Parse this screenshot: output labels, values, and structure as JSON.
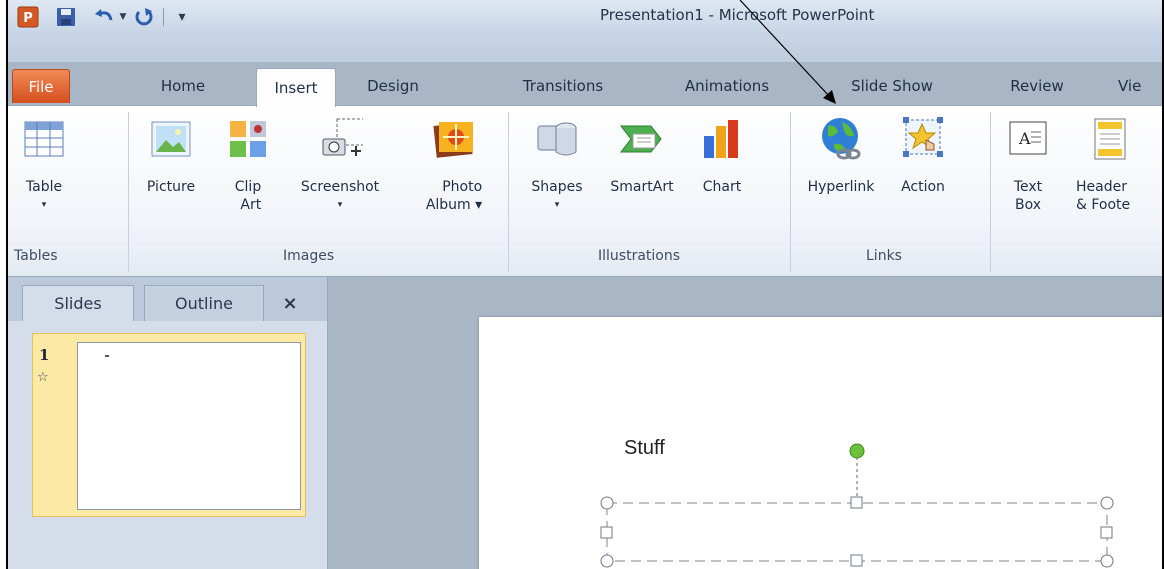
{
  "window": {
    "title": "Presentation1 - Microsoft PowerPoint"
  },
  "quick_access": {
    "app_icon_letter": "P",
    "customize_glyph": "▾"
  },
  "tabs": [
    {
      "label": "File"
    },
    {
      "label": "Home"
    },
    {
      "label": "Insert"
    },
    {
      "label": "Design"
    },
    {
      "label": "Transitions"
    },
    {
      "label": "Animations"
    },
    {
      "label": "Slide Show"
    },
    {
      "label": "Review"
    },
    {
      "label": "Vie"
    }
  ],
  "ribbon": {
    "tables": {
      "group_label": "Tables",
      "table": "Table",
      "table_drop": "▾"
    },
    "images": {
      "group_label": "Images",
      "picture": "Picture",
      "clip_art": "Clip\nArt",
      "screenshot": "Screenshot",
      "screenshot_drop": "▾",
      "photo_album": "Photo\nAlbum ▾"
    },
    "illustrations": {
      "group_label": "Illustrations",
      "shapes": "Shapes",
      "shapes_drop": "▾",
      "smartart": "SmartArt",
      "chart": "Chart"
    },
    "links": {
      "group_label": "Links",
      "hyperlink": "Hyperlink",
      "action": "Action"
    },
    "text": {
      "text_box": "Text\nBox",
      "header_footer": "Header\n& Foote"
    }
  },
  "slides_pane": {
    "tab_slides": "Slides",
    "tab_outline": "Outline",
    "close": "×",
    "slide_number": "1"
  },
  "slide": {
    "text": "Stuff"
  },
  "colors": {
    "file_tab": "#d44f1e",
    "ribbon_bg": "#f1f4f9",
    "selection": "#fde9a6",
    "rotate_handle": "#6fc03a"
  }
}
